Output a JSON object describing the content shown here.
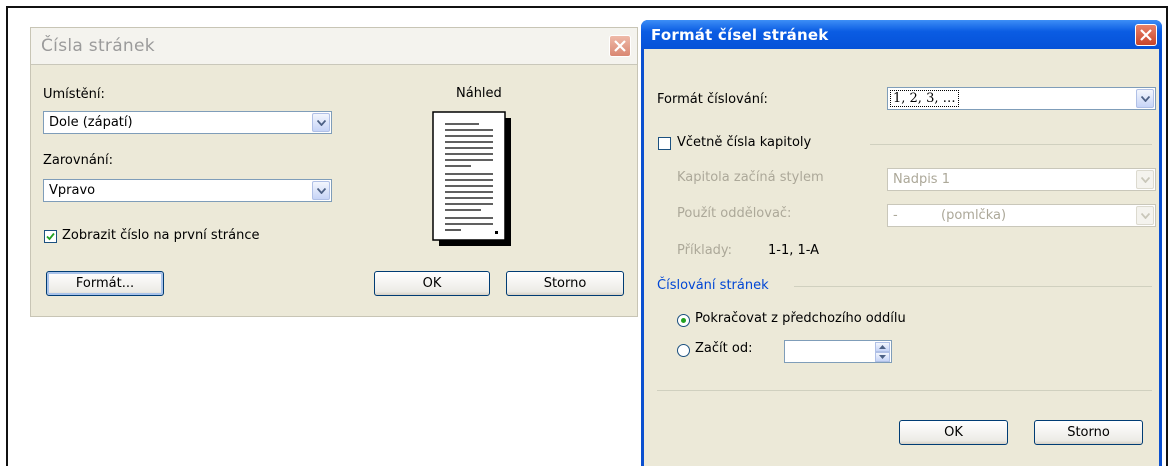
{
  "page_numbers_dialog": {
    "title": "Čísla stránek",
    "position_label": "Umístění:",
    "position_value": "Dole (zápatí)",
    "alignment_label": "Zarovnání:",
    "alignment_value": "Vpravo",
    "show_first_page_label": "Zobrazit číslo na první stránce",
    "show_first_page_checked": true,
    "preview_label": "Náhled",
    "format_button": "Formát...",
    "ok_button": "OK",
    "cancel_button": "Storno"
  },
  "format_dialog": {
    "title": "Formát čísel stránek",
    "number_format_label": "Formát číslování:",
    "number_format_value": "1, 2, 3, …",
    "include_chapter_label": "Včetně čísla kapitoly",
    "include_chapter_checked": false,
    "chapter_starts_label": "Kapitola začíná stylem",
    "chapter_starts_value": "Nadpis 1",
    "separator_label": "Použít oddělovač:",
    "separator_value_symbol": "-",
    "separator_value_name": "(pomlčka)",
    "examples_label": "Příklady:",
    "examples_value": "1-1, 1-A",
    "numbering_group": "Číslování stránek",
    "continue_label": "Pokračovat z předchozího oddílu",
    "start_at_label": "Začít od:",
    "start_at_value": "",
    "selected_option": "continue",
    "ok_button": "OK",
    "cancel_button": "Storno"
  },
  "colors": {
    "title_bar_blue": "#0a5ce3",
    "dialog_background": "#ece9d8",
    "group_header": "#0046d5",
    "disabled_text": "#aca899"
  },
  "icons": [
    "close-icon",
    "chevron-down-icon",
    "check-icon",
    "spin-up-icon",
    "spin-down-icon",
    "page-preview-icon"
  ]
}
